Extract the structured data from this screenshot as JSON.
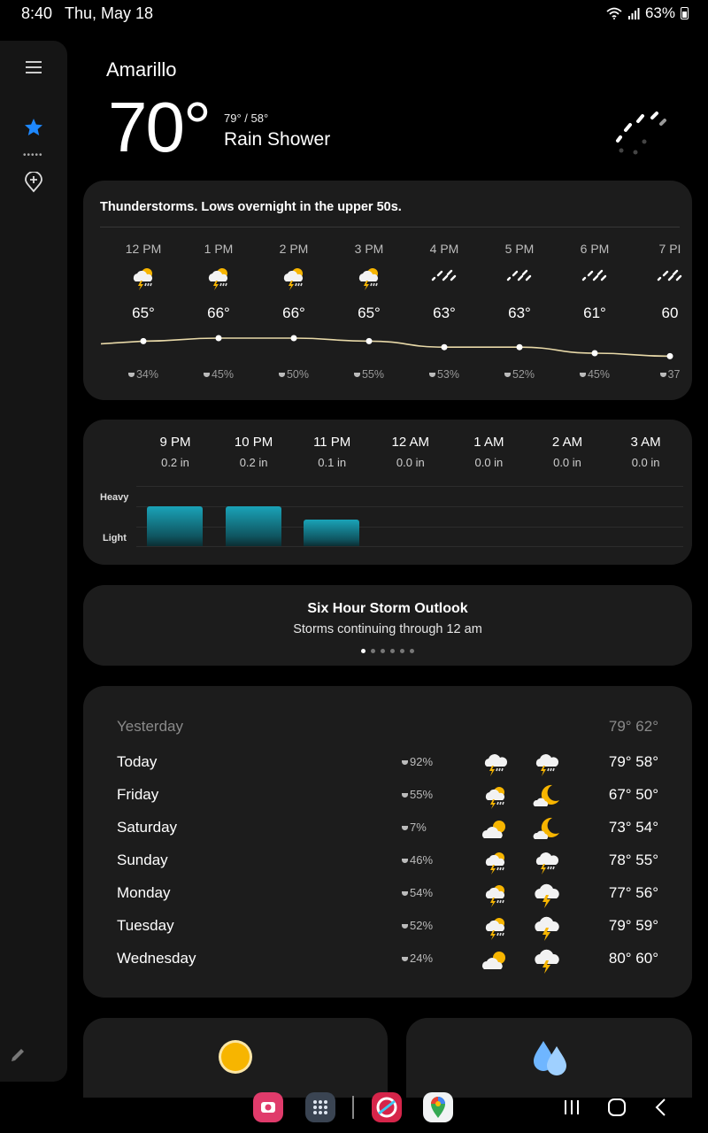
{
  "status_bar": {
    "time": "8:40",
    "date": "Thu, May 18",
    "battery": "63%"
  },
  "location": {
    "city": "Amarillo",
    "temp": "70°",
    "hilo": "79° / 58°",
    "condition": "Rain Shower"
  },
  "hourly": {
    "summary": "Thunderstorms. Lows overnight in the upper 50s.",
    "hours": [
      {
        "time": "12 PM",
        "icon": "thunderstorm-sun-icon",
        "temp": "65°",
        "precip": "34%",
        "value": 65
      },
      {
        "time": "1 PM",
        "icon": "thunderstorm-sun-icon",
        "temp": "66°",
        "precip": "45%",
        "value": 66
      },
      {
        "time": "2 PM",
        "icon": "thunderstorm-sun-icon",
        "temp": "66°",
        "precip": "50%",
        "value": 66
      },
      {
        "time": "3 PM",
        "icon": "thunderstorm-sun-icon",
        "temp": "65°",
        "precip": "55%",
        "value": 65
      },
      {
        "time": "4 PM",
        "icon": "rain-icon",
        "temp": "63°",
        "precip": "53%",
        "value": 63
      },
      {
        "time": "5 PM",
        "icon": "rain-icon",
        "temp": "63°",
        "precip": "52%",
        "value": 63
      },
      {
        "time": "6 PM",
        "icon": "rain-icon",
        "temp": "61°",
        "precip": "45%",
        "value": 61
      },
      {
        "time": "7 PI",
        "icon": "rain-icon",
        "temp": "60",
        "precip": "37",
        "value": 60
      }
    ]
  },
  "precip": {
    "labels": {
      "heavy": "Heavy",
      "light": "Light"
    },
    "hours": [
      {
        "time": "9 PM",
        "amount": "0.2 in",
        "value": 0.2
      },
      {
        "time": "10 PM",
        "amount": "0.2 in",
        "value": 0.2
      },
      {
        "time": "11 PM",
        "amount": "0.1 in",
        "value": 0.1
      },
      {
        "time": "12 AM",
        "amount": "0.0 in",
        "value": 0.0
      },
      {
        "time": "1 AM",
        "amount": "0.0 in",
        "value": 0.0
      },
      {
        "time": "2 AM",
        "amount": "0.0 in",
        "value": 0.0
      },
      {
        "time": "3 AM",
        "amount": "0.0 in",
        "value": 0.0
      }
    ]
  },
  "storm": {
    "title": "Six Hour Storm Outlook",
    "subtitle": "Storms continuing through 12 am"
  },
  "daily": {
    "yesterday": {
      "label": "Yesterday",
      "temps": "79° 62°"
    },
    "days": [
      {
        "day": "Today",
        "precip": "92%",
        "day_icon": "thunderstorm-cloud-icon",
        "night_icon": "thunderstorm-cloud-icon",
        "temps": "79° 58°"
      },
      {
        "day": "Friday",
        "precip": "55%",
        "day_icon": "thunderstorm-sun-icon",
        "night_icon": "moon-cloud-icon",
        "temps": "67° 50°"
      },
      {
        "day": "Saturday",
        "precip": "7%",
        "day_icon": "partly-cloudy-icon",
        "night_icon": "moon-cloud-icon",
        "temps": "73° 54°"
      },
      {
        "day": "Sunday",
        "precip": "46%",
        "day_icon": "thunderstorm-sun-icon",
        "night_icon": "thunderstorm-cloud-icon",
        "temps": "78° 55°"
      },
      {
        "day": "Monday",
        "precip": "54%",
        "day_icon": "thunderstorm-sun-icon",
        "night_icon": "lightning-cloud-icon",
        "temps": "77° 56°"
      },
      {
        "day": "Tuesday",
        "precip": "52%",
        "day_icon": "thunderstorm-sun-icon",
        "night_icon": "lightning-cloud-icon",
        "temps": "79° 59°"
      },
      {
        "day": "Wednesday",
        "precip": "24%",
        "day_icon": "partly-cloudy-icon",
        "night_icon": "lightning-cloud-icon",
        "temps": "80° 60°"
      }
    ]
  },
  "colors": {
    "background": "#000000",
    "card": "#1c1c1c",
    "accent_blue": "#1e88ff",
    "bar_cyan": "#1aa3b8",
    "sun": "#f7b500"
  }
}
